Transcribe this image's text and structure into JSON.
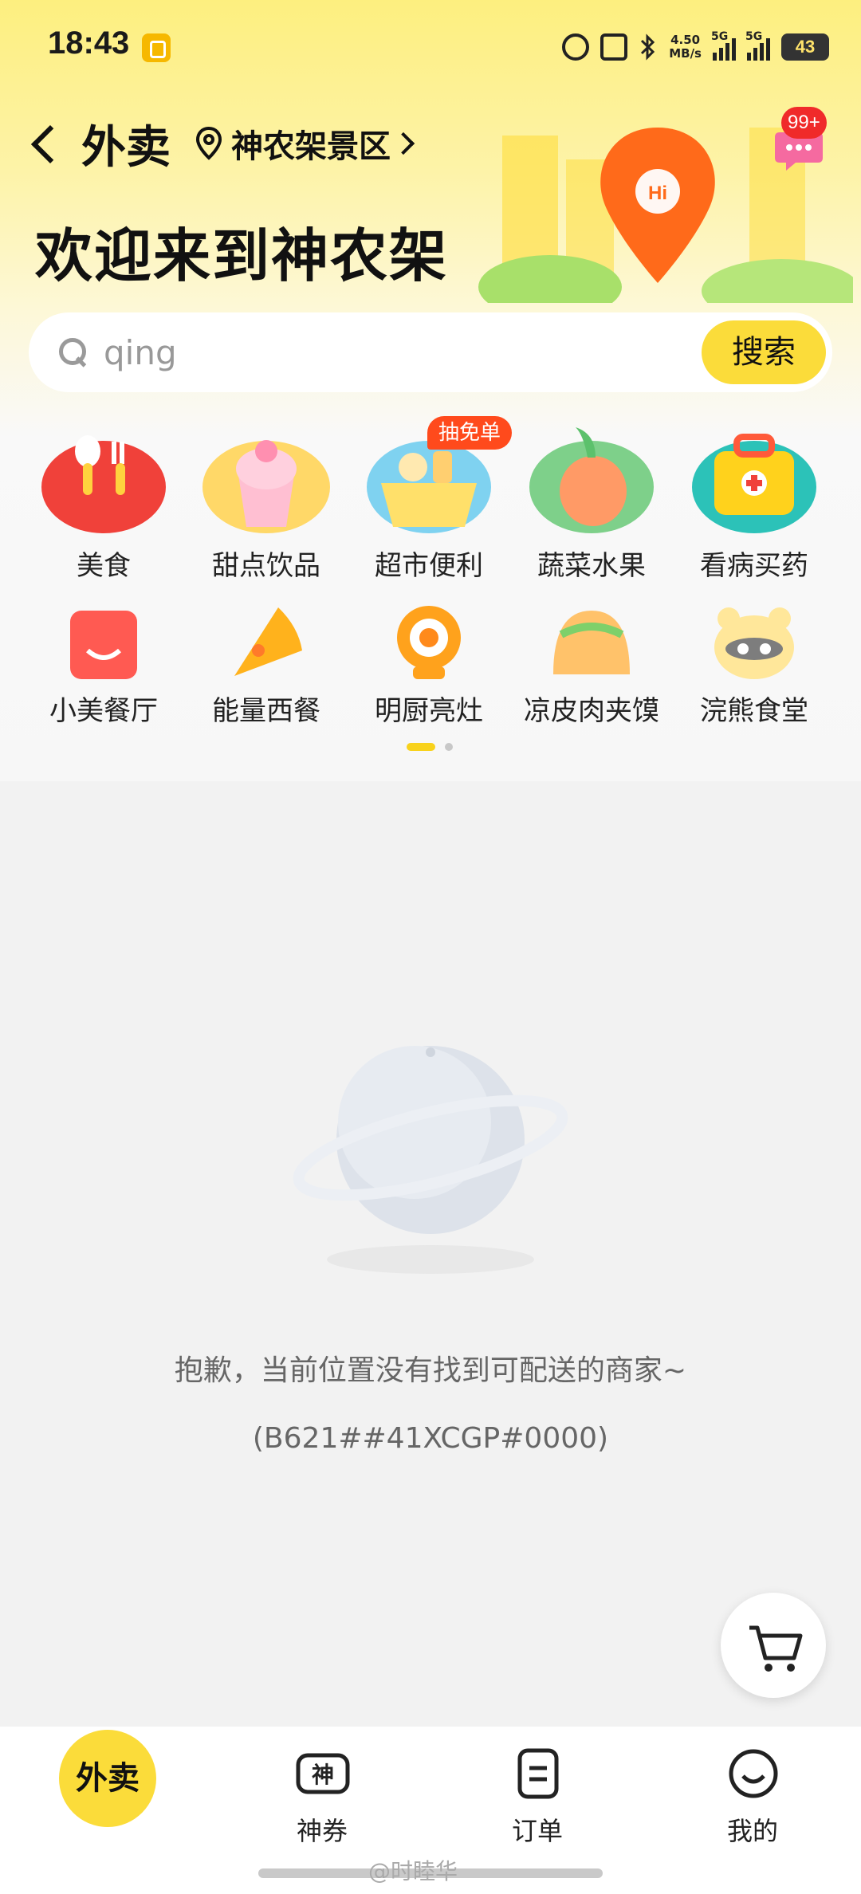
{
  "status_bar": {
    "time": "18:43",
    "net_speed_top": "4.50",
    "net_speed_unit": "MB/s",
    "signal1": "5G",
    "signal2": "5G",
    "battery": "43"
  },
  "header": {
    "title": "外卖",
    "location": "神农架景区",
    "welcome": "欢迎来到神农架",
    "badge": "99+"
  },
  "search": {
    "value": "qing",
    "button": "搜索"
  },
  "categories": [
    {
      "label": "美食",
      "icon": "spoon-fork-icon"
    },
    {
      "label": "甜点饮品",
      "icon": "ice-cream-icon"
    },
    {
      "label": "超市便利",
      "icon": "basket-icon"
    },
    {
      "label": "蔬菜水果",
      "icon": "fruit-icon"
    },
    {
      "label": "看病买药",
      "icon": "medical-kit-icon"
    },
    {
      "label": "小美餐厅",
      "icon": "shop-icon"
    },
    {
      "label": "能量西餐",
      "icon": "pizza-icon"
    },
    {
      "label": "明厨亮灶",
      "icon": "camera-icon"
    },
    {
      "label": "凉皮肉夹馍",
      "icon": "taco-icon"
    },
    {
      "label": "浣熊食堂",
      "icon": "raccoon-icon"
    }
  ],
  "promo_tag": "抽免单",
  "empty_state": {
    "message": "抱歉，当前位置没有找到可配送的商家~",
    "code": "(B621##41XCGP#0000)"
  },
  "bottom_nav": {
    "home": "外卖",
    "tabs": [
      {
        "label": "神券",
        "icon": "coupon-icon"
      },
      {
        "label": "订单",
        "icon": "order-icon"
      },
      {
        "label": "我的",
        "icon": "profile-icon"
      }
    ]
  },
  "watermark": "@时睦华",
  "colors": {
    "brand_yellow": "#fbdc3a",
    "tag_red": "#ff4a1c"
  }
}
